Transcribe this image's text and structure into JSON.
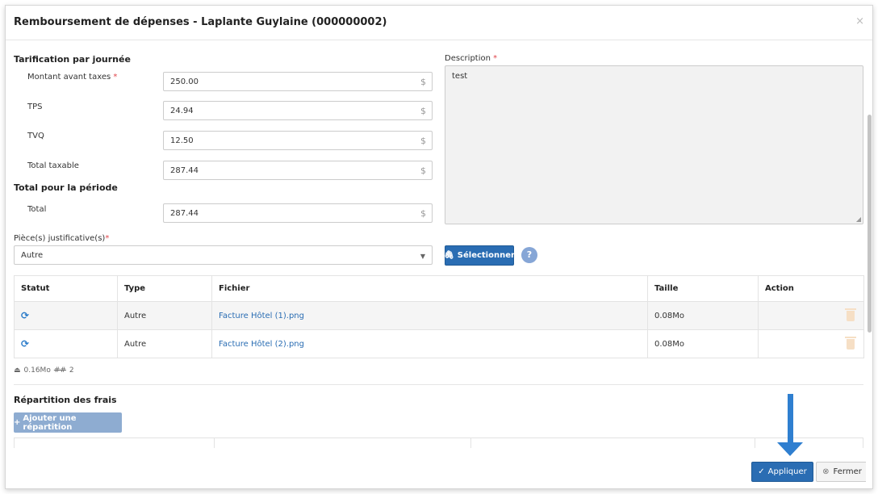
{
  "modal": {
    "title": "Remboursement de dépenses - Laplante Guylaine (000000002)",
    "close_label": "×"
  },
  "tarification": {
    "title": "Tarification par journée",
    "fields": [
      {
        "label": "Montant avant taxes",
        "required": "*",
        "value": "250.00",
        "currency": "$"
      },
      {
        "label": "TPS",
        "value": "24.94",
        "currency": "$"
      },
      {
        "label": "TVQ",
        "value": "12.50",
        "currency": "$"
      },
      {
        "label": "Total taxable",
        "value": "287.44",
        "currency": "$"
      }
    ]
  },
  "total_periode": {
    "title": "Total pour la période",
    "label": "Total",
    "value": "287.44",
    "currency": "$"
  },
  "description": {
    "label": "Description",
    "required": "*",
    "value": "test"
  },
  "pieces": {
    "label": "Pièce(s) justificative(s)",
    "required": "*",
    "selected": "Autre",
    "select_button": "Sélectionner",
    "help": "?"
  },
  "files_table": {
    "headers": [
      "Statut",
      "Type",
      "Fichier",
      "Taille",
      "Action"
    ],
    "rows": [
      {
        "type": "Autre",
        "file": "Facture Hôtel (1).png",
        "size": "0.08Mo"
      },
      {
        "type": "Autre",
        "file": "Facture Hôtel (2).png",
        "size": "0.08Mo"
      }
    ],
    "summary_size": "0.16Mo",
    "summary_count": "2"
  },
  "repartition": {
    "title": "Répartition des frais",
    "add_button": "Ajouter une répartition"
  },
  "footer": {
    "apply_label": "Appliquer",
    "close_label": "Fermer"
  },
  "colors": {
    "primary": "#2a6db3",
    "required": "#e0454b",
    "arrow": "#2f7fd0"
  }
}
